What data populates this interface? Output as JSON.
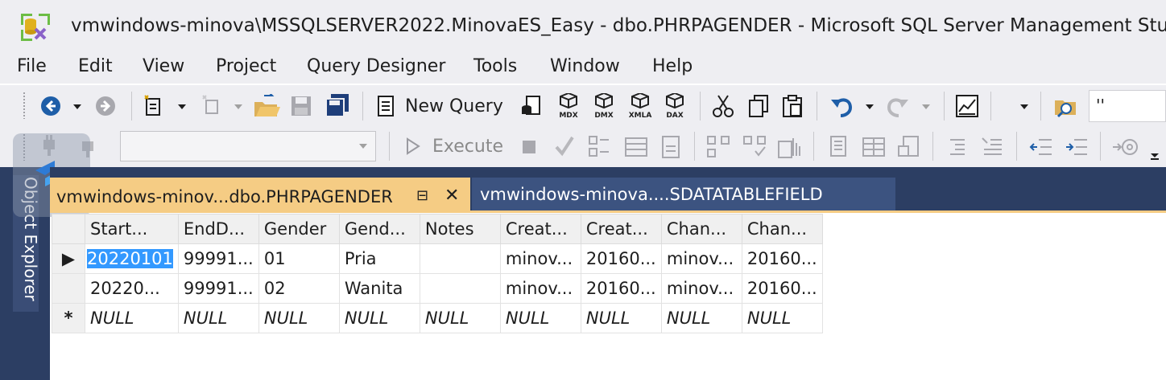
{
  "window": {
    "title": "vmwindows-minova\\MSSQLSERVER2022.MinovaES_Easy - dbo.PHRPAGENDER - Microsoft SQL Server Management Studio"
  },
  "menu": [
    "File",
    "Edit",
    "View",
    "Project",
    "Query Designer",
    "Tools",
    "Window",
    "Help"
  ],
  "toolbar": {
    "new_query_label": "New Query",
    "query_icons": [
      "MDX",
      "DMX",
      "XMLA",
      "DAX"
    ],
    "execute_label": "Execute",
    "search_value": "''"
  },
  "side_panel": {
    "label": "Object Explorer"
  },
  "tabs": [
    {
      "label": "vmwindows-minov...dbo.PHRPAGENDER",
      "active": true,
      "pin": "⊟",
      "close": "✕"
    },
    {
      "label": "vmwindows-minova....SDATATABLEFIELD",
      "active": false
    }
  ],
  "grid": {
    "columns": [
      "Start...",
      "EndD...",
      "Gender",
      "Gend...",
      "Notes",
      "Creat...",
      "Creat...",
      "Chan...",
      "Chan..."
    ],
    "rows": [
      {
        "marker": "▶",
        "cells": [
          "20220101",
          "99991...",
          "01",
          "Pria",
          "",
          "minov...",
          "20160...",
          "minov...",
          "20160..."
        ]
      },
      {
        "marker": "",
        "cells": [
          "20220...",
          "99991...",
          "02",
          "Wanita",
          "",
          "minov...",
          "20160...",
          "minov...",
          "20160..."
        ]
      },
      {
        "marker": "*",
        "cells": [
          "NULL",
          "NULL",
          "NULL",
          "NULL",
          "NULL",
          "NULL",
          "NULL",
          "NULL",
          "NULL"
        ]
      }
    ]
  },
  "colors": {
    "chrome_bg": "#eeeef2",
    "panel_navy": "#2c3e63",
    "active_tab": "#f5cc84",
    "selection": "#3399ff"
  }
}
